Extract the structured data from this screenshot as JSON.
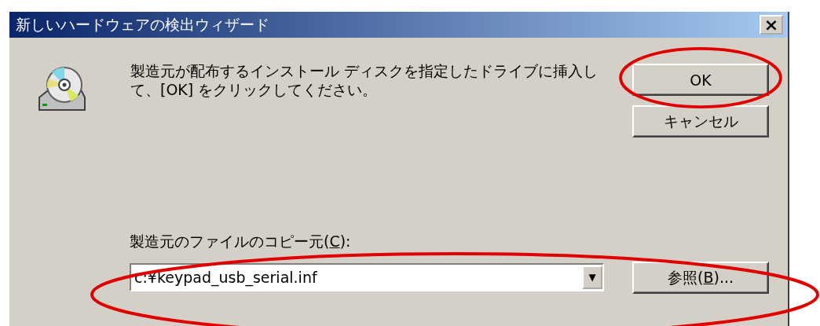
{
  "window": {
    "title": "新しいハードウェアの検出ウィザード",
    "close": "×"
  },
  "message": "製造元が配布するインストール ディスクを指定したドライブに挿入して、[OK] をクリックしてください。",
  "buttons": [
    {
      "label": "OK"
    },
    {
      "label": "キャンセル"
    }
  ],
  "copy_from": {
    "label": "製造元のファイルのコピー元(",
    "mnemonic": "C",
    "label_end": "):",
    "value": "c:¥keypad_usb_serial.inf",
    "dropdown": "▼"
  },
  "browse_button": {
    "label": "参照(",
    "mnemonic": "B",
    "label_end": ")..."
  }
}
